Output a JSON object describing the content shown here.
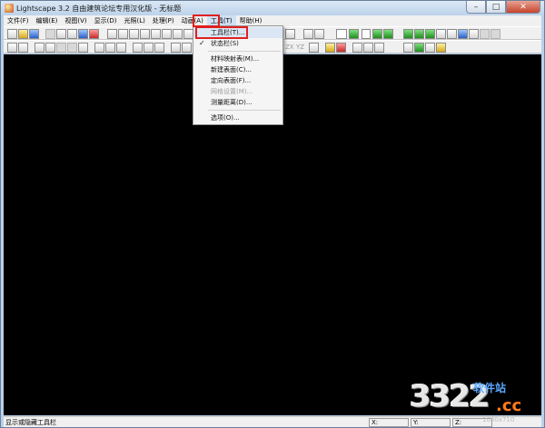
{
  "window": {
    "title": "Lightscape 3.2 自由建筑论坛专用汉化版 - 无标题",
    "controls": [
      "–",
      "□",
      "✕"
    ]
  },
  "menubar": {
    "items": [
      "文件(F)",
      "编辑(E)",
      "视图(V)",
      "显示(D)",
      "光照(L)",
      "处理(P)",
      "动画(A)",
      "工具(T)",
      "帮助(H)"
    ],
    "active": "工具(T)"
  },
  "toolbar": {
    "view_labels": [
      "ZX",
      "YZ"
    ]
  },
  "tools_menu": {
    "items": [
      {
        "label": "工具栏(T)...",
        "checked": false,
        "disabled": false
      },
      {
        "label": "状态栏(S)",
        "checked": true,
        "disabled": false
      },
      {
        "label": "材料映射表(M)...",
        "checked": false,
        "disabled": false
      },
      {
        "label": "新建表面(C)...",
        "checked": false,
        "disabled": false
      },
      {
        "label": "定向表面(F)...",
        "checked": false,
        "disabled": false
      },
      {
        "label": "网格设置(M)...",
        "checked": false,
        "disabled": true
      },
      {
        "label": "测量距离(D)...",
        "checked": false,
        "disabled": false
      },
      {
        "label": "选项(O)...",
        "checked": false,
        "disabled": false
      }
    ],
    "check_glyph": "✓",
    "highlight_color": "#e02020"
  },
  "statusbar": {
    "text": "显示或隐藏工具栏",
    "x_label": "X:",
    "y_label": "Y:",
    "z_label": "Z:"
  },
  "watermark": {
    "number": "3322",
    "site": "软件站",
    "domain": ".cc",
    "resolution": "1080x710"
  },
  "colors": {
    "viewport": "#000000",
    "title_gradient_top": "#dbe8f5",
    "close_button": "#c6432b"
  }
}
